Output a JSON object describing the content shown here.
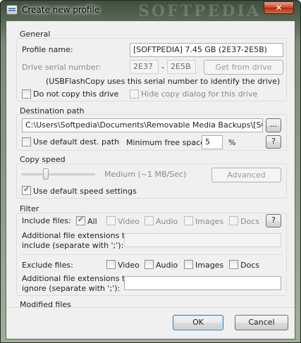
{
  "window": {
    "title": "Create new profile",
    "watermark": "SOFTPEDIA",
    "close_glyph": "✕"
  },
  "general": {
    "label": "General",
    "profile_name_label": "Profile name:",
    "profile_name_value": "[SOFTPEDIA] 7.45 GB (2E37-2E5B)",
    "serial_label": "Drive serial number:",
    "serial_part1": "2E37",
    "serial_sep": "-",
    "serial_part2": "2E5B",
    "get_from_drive": "Get from drive",
    "serial_note": "(USBFlashCopy uses this serial number to identify the drive)",
    "do_not_copy": "Do not copy this drive",
    "hide_copy_dialog": "Hide copy dialog for this drive"
  },
  "destination": {
    "label": "Destination path",
    "path_value": "C:\\Users\\Softpedia\\Documents\\Removable Media Backups\\[SOFTPEDIA]",
    "browse": "...",
    "use_default": "Use default dest. path",
    "min_free_label": "Minimum free space:",
    "min_free_value": "5",
    "min_free_unit": "%",
    "help": "?"
  },
  "copy_speed": {
    "label": "Copy speed",
    "speed_text": "Medium (~1 MB/Sec)",
    "slider_fraction": 0.33,
    "advanced": "Advanced",
    "use_default_speed": "Use default speed settings"
  },
  "filter": {
    "label": "Filter",
    "include_label": "Include files:",
    "include_all": "All",
    "include_video": "Video",
    "include_audio": "Audio",
    "include_images": "Images",
    "include_docs": "Docs",
    "help": "?",
    "include_ext_label_1": "Additional file extensions to",
    "include_ext_label_2": "include (separate with ';'):",
    "include_ext_value": "",
    "exclude_label": "Exclude files:",
    "exclude_video": "Video",
    "exclude_audio": "Audio",
    "exclude_images": "Images",
    "exclude_docs": "Docs",
    "exclude_ext_label_1": "Additional file extensions to",
    "exclude_ext_label_2": "ignore (separate with ';'):",
    "exclude_ext_value": ""
  },
  "modified": {
    "label": "Modified files"
  },
  "footer": {
    "ok": "OK",
    "cancel": "Cancel"
  }
}
